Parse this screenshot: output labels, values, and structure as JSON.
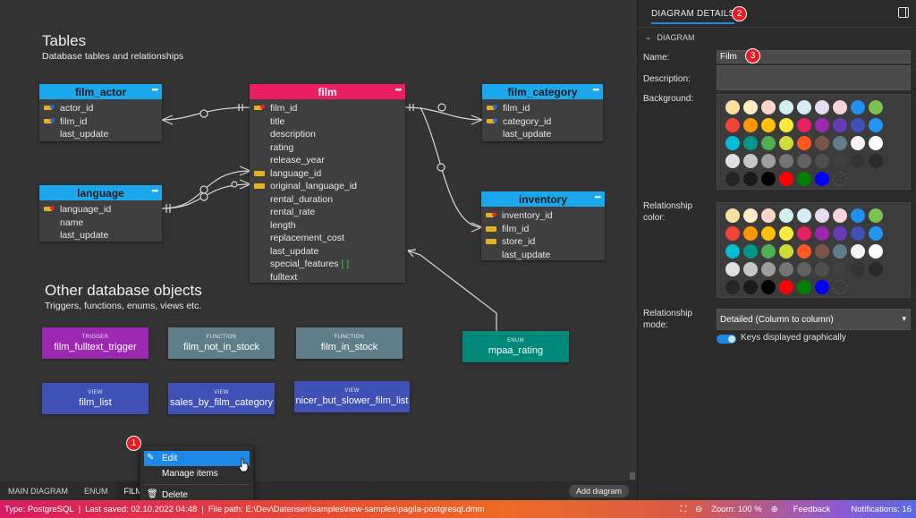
{
  "canvas": {
    "tables_title": "Tables",
    "tables_subtitle": "Database tables and relationships",
    "other_title": "Other database objects",
    "other_subtitle": "Triggers, functions, enums, views etc."
  },
  "tables": {
    "film_actor": {
      "name": "film_actor",
      "columns": [
        "actor_id",
        "film_id",
        "last_update"
      ]
    },
    "film": {
      "name": "film",
      "columns": [
        "film_id",
        "title",
        "description",
        "rating",
        "release_year",
        "language_id",
        "original_language_id",
        "rental_duration",
        "rental_rate",
        "length",
        "replacement_cost",
        "last_update",
        "special_features",
        "fulltext"
      ],
      "array_marker": "[ ]"
    },
    "film_category": {
      "name": "film_category",
      "columns": [
        "film_id",
        "category_id",
        "last_update"
      ]
    },
    "language": {
      "name": "language",
      "columns": [
        "language_id",
        "name",
        "last_update"
      ]
    },
    "inventory": {
      "name": "inventory",
      "columns": [
        "inventory_id",
        "film_id",
        "store_id",
        "last_update"
      ]
    }
  },
  "table_menu_glyph": "•••",
  "objects": {
    "trigger": {
      "type": "TRIGGER",
      "name": "film_fulltext_trigger",
      "color": "#9c27b0"
    },
    "film_not_in_stock": {
      "type": "FUNCTION",
      "name": "film_not_in_stock",
      "color": "#607d8b"
    },
    "film_in_stock": {
      "type": "FUNCTION",
      "name": "film_in_stock",
      "color": "#607d8b"
    },
    "mpaa_rating": {
      "type": "ENUM",
      "name": "mpaa_rating",
      "color": "#00897b"
    },
    "film_list": {
      "type": "VIEW",
      "name": "film_list",
      "color": "#3f51b5"
    },
    "sales_by_film_category": {
      "type": "VIEW",
      "name": "sales_by_film_category",
      "color": "#3f51b5"
    },
    "nicer_but_slower_film_list": {
      "type": "VIEW",
      "name": "nicer_but_slower_film_list",
      "color": "#3f51b5"
    }
  },
  "tabs": [
    "MAIN DIAGRAM",
    "ENUM",
    "FILM"
  ],
  "add_diagram": "Add diagram",
  "context_menu": {
    "edit": "Edit",
    "manage": "Manage items",
    "delete": "Delete"
  },
  "badges": {
    "one": "1",
    "two": "2",
    "three": "3"
  },
  "panel": {
    "tab": "DIAGRAM DETAILS",
    "section": "DIAGRAM",
    "name_label": "Name:",
    "name_value": "Film",
    "description_label": "Description:",
    "description_value": "",
    "background_label": "Background:",
    "relationship_color_label": "Relationship color:",
    "relationship_mode_label": "Relationship mode:",
    "relationship_mode_value": "Detailed (Column to column)",
    "keys_label": "Keys displayed graphically",
    "palette": [
      "#ffe0a0",
      "#ffedc8",
      "#ffd5c8",
      "#d0f0ec",
      "#d6ecf6",
      "#e6dcf2",
      "#f8d4dc",
      "#1e90f0",
      "#7cc250",
      "#f44336",
      "#ff9800",
      "#ffc107",
      "#ffeb3b",
      "#e91e63",
      "#9c27b0",
      "#673ab7",
      "#3f51b5",
      "#2196f3",
      "#00bcd4",
      "#009688",
      "#4caf50",
      "#cddc39",
      "#ff5722",
      "#795548",
      "#607d8b",
      "#f5f5f5",
      "#ffffff",
      "#e0e0e0",
      "#c6c6c6",
      "#9e9e9e",
      "#757575",
      "#616161",
      "#4e4e4e",
      "#404040",
      "#333333",
      "#2a2a2a",
      "#262626",
      "#1a1a1a",
      "#000000",
      "#ff0000",
      "#008000",
      "#0000ff",
      "x"
    ]
  },
  "status": {
    "type": "Type: PostgreSQL",
    "saved": "Last saved: 02.10.2022 04:48",
    "path": "File path: E:\\Dev\\Datensen\\samples\\new-samples\\pagila-postgresql.dmm",
    "zoom": "Zoom: 100 %",
    "feedback": "Feedback",
    "notifications": "Notifications: 16"
  }
}
